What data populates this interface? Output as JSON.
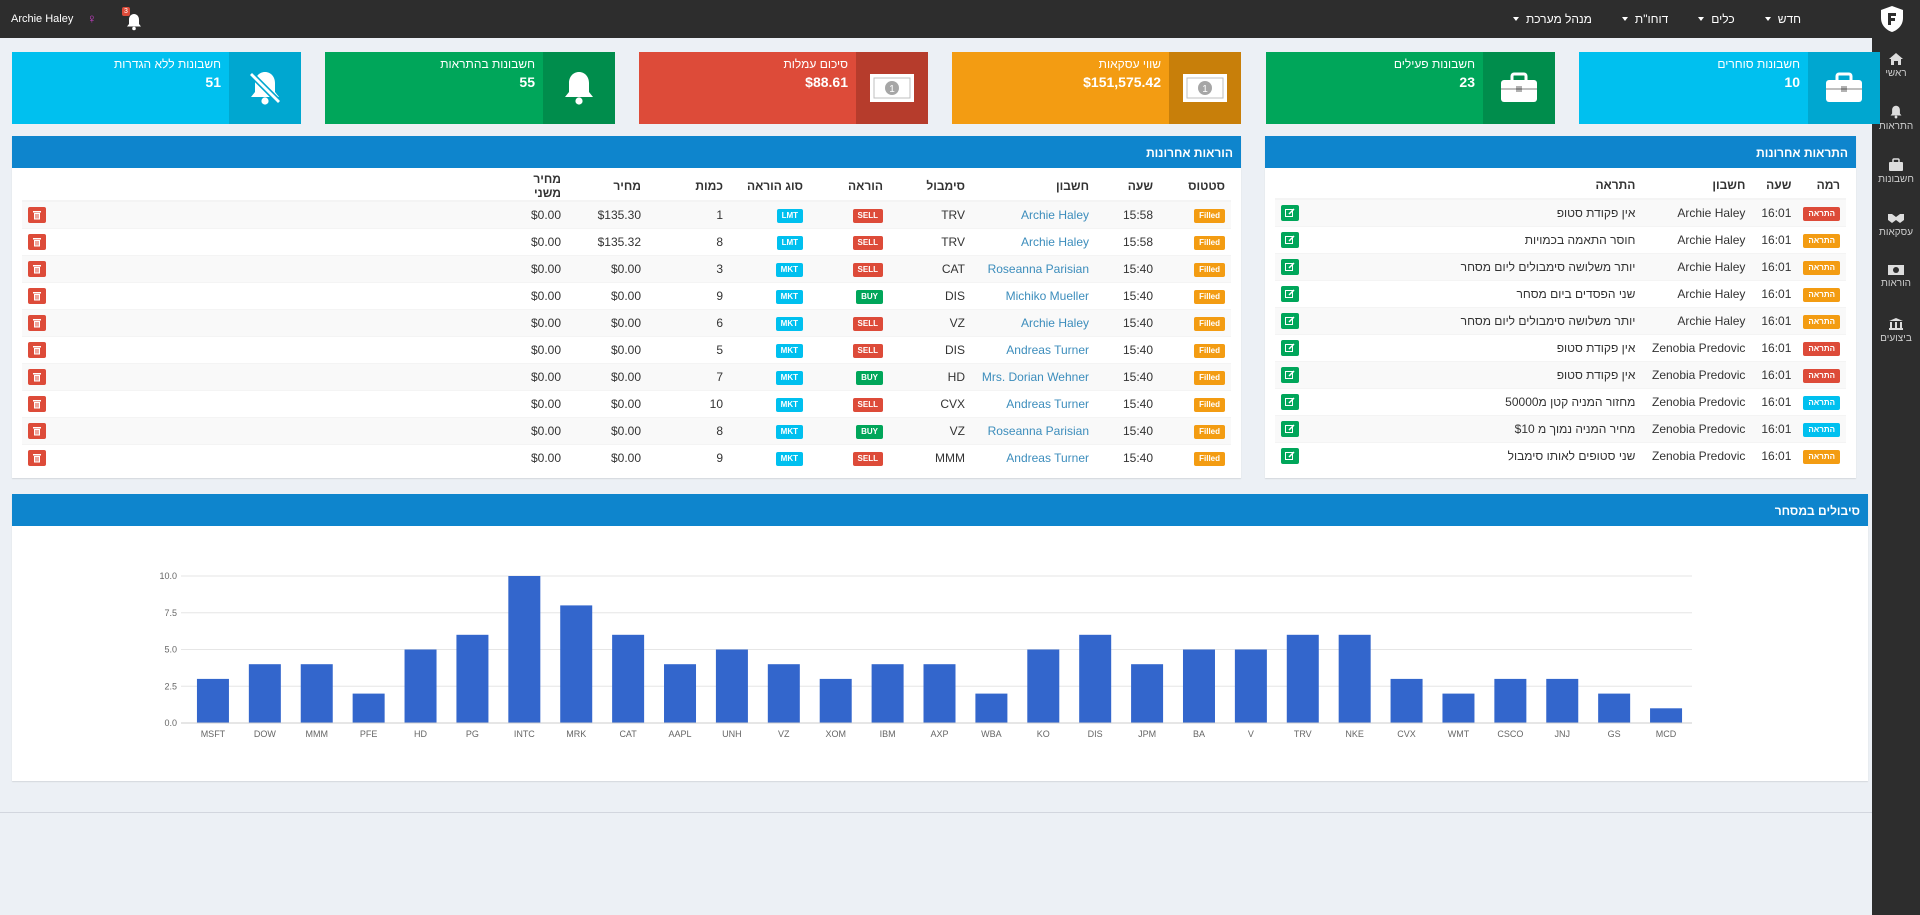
{
  "topbar": {
    "user_name": "Archie Haley",
    "gender_symbol": "♀",
    "notifications_count": "3",
    "nav": [
      {
        "label": "חדש"
      },
      {
        "label": "כלים"
      },
      {
        "label": "דוחו\"ת"
      },
      {
        "label": "מנהל מערכת"
      }
    ]
  },
  "sidebar": {
    "items": [
      {
        "label": "ראשי",
        "icon": "home-icon"
      },
      {
        "label": "התראות",
        "icon": "bell-icon"
      },
      {
        "label": "חשבונות",
        "icon": "briefcase-icon"
      },
      {
        "label": "עסקאות",
        "icon": "handshake-icon"
      },
      {
        "label": "הוראות",
        "icon": "money-icon"
      },
      {
        "label": "ביצועים",
        "icon": "bank-icon"
      }
    ]
  },
  "info_boxes": [
    {
      "title": "חשבונות סוחרים",
      "value": "10",
      "color": "#00c0ef",
      "icon_bg": "#00a7d0",
      "icon": "briefcase-icon"
    },
    {
      "title": "חשבונות פעילים",
      "value": "23",
      "color": "#00a65a",
      "icon_bg": "#008d4c",
      "icon": "briefcase-icon"
    },
    {
      "title": "שווי עסקאות",
      "value": "$151,575.42",
      "color": "#f39c12",
      "icon_bg": "#c87f0a",
      "icon": "money-icon"
    },
    {
      "title": "סיכום עמלות",
      "value": "$88.61",
      "color": "#dd4b39",
      "icon_bg": "#b63c2c",
      "icon": "money-icon"
    },
    {
      "title": "חשבונות בהתראות",
      "value": "55",
      "color": "#00a65a",
      "icon_bg": "#008d4c",
      "icon": "bell-icon"
    },
    {
      "title": "חשבונות ללא הגדרות",
      "value": "51",
      "color": "#00c0ef",
      "icon_bg": "#00a7d0",
      "icon": "bell-slash-icon"
    }
  ],
  "alerts_panel": {
    "title": "התראות אחרונות",
    "headers": [
      "רמה",
      "שעה",
      "חשבון",
      "התראה"
    ],
    "rows": [
      {
        "level": "התראה",
        "level_color": "red",
        "time": "16:01",
        "account": "Archie Haley",
        "alert": "אין פקודת סטופ"
      },
      {
        "level": "התראה",
        "level_color": "orange",
        "time": "16:01",
        "account": "Archie Haley",
        "alert": "חוסר התאמה בכמויות"
      },
      {
        "level": "התראה",
        "level_color": "orange",
        "time": "16:01",
        "account": "Archie Haley",
        "alert": "יותר משלושה סימבולים ליום מסחר"
      },
      {
        "level": "התראה",
        "level_color": "orange",
        "time": "16:01",
        "account": "Archie Haley",
        "alert": "שני הפסדים ביום מסחר"
      },
      {
        "level": "התראה",
        "level_color": "orange",
        "time": "16:01",
        "account": "Archie Haley",
        "alert": "יותר משלושה סימבולים ליום מסחר"
      },
      {
        "level": "התראה",
        "level_color": "red",
        "time": "16:01",
        "account": "Zenobia Predovic",
        "alert": "אין פקודת סטופ"
      },
      {
        "level": "התראה",
        "level_color": "red",
        "time": "16:01",
        "account": "Zenobia Predovic",
        "alert": "אין פקודת סטופ"
      },
      {
        "level": "התראה",
        "level_color": "cyan",
        "time": "16:01",
        "account": "Zenobia Predovic",
        "alert": "מחזור המניה קטן מ50000"
      },
      {
        "level": "התראה",
        "level_color": "cyan",
        "time": "16:01",
        "account": "Zenobia Predovic",
        "alert": "מחיר המניה נמוך מ $10"
      },
      {
        "level": "התראה",
        "level_color": "orange",
        "time": "16:01",
        "account": "Zenobia Predovic",
        "alert": "שני סטופים לאותו סימבול"
      }
    ]
  },
  "orders_panel": {
    "title": "הוראות אחרונות",
    "headers": [
      "סטטוס",
      "שעה",
      "חשבון",
      "סימבול",
      "הוראה",
      "סוג הוראה",
      "כמות",
      "מחיר",
      "מחיר משני"
    ],
    "rows": [
      {
        "status": "Filled",
        "time": "15:58",
        "account": "Archie Haley",
        "symbol": "TRV",
        "side": "SELL",
        "type": "LMT",
        "qty": "1",
        "price": "$135.30",
        "price2": "$0.00"
      },
      {
        "status": "Filled",
        "time": "15:58",
        "account": "Archie Haley",
        "symbol": "TRV",
        "side": "SELL",
        "type": "LMT",
        "qty": "8",
        "price": "$135.32",
        "price2": "$0.00"
      },
      {
        "status": "Filled",
        "time": "15:40",
        "account": "Roseanna Parisian",
        "symbol": "CAT",
        "side": "SELL",
        "type": "MKT",
        "qty": "3",
        "price": "$0.00",
        "price2": "$0.00"
      },
      {
        "status": "Filled",
        "time": "15:40",
        "account": "Michiko Mueller",
        "symbol": "DIS",
        "side": "BUY",
        "type": "MKT",
        "qty": "9",
        "price": "$0.00",
        "price2": "$0.00"
      },
      {
        "status": "Filled",
        "time": "15:40",
        "account": "Archie Haley",
        "symbol": "VZ",
        "side": "SELL",
        "type": "MKT",
        "qty": "6",
        "price": "$0.00",
        "price2": "$0.00"
      },
      {
        "status": "Filled",
        "time": "15:40",
        "account": "Andreas Turner",
        "symbol": "DIS",
        "side": "SELL",
        "type": "MKT",
        "qty": "5",
        "price": "$0.00",
        "price2": "$0.00"
      },
      {
        "status": "Filled",
        "time": "15:40",
        "account": "Mrs. Dorian Wehner",
        "symbol": "HD",
        "side": "BUY",
        "type": "MKT",
        "qty": "7",
        "price": "$0.00",
        "price2": "$0.00"
      },
      {
        "status": "Filled",
        "time": "15:40",
        "account": "Andreas Turner",
        "symbol": "CVX",
        "side": "SELL",
        "type": "MKT",
        "qty": "10",
        "price": "$0.00",
        "price2": "$0.00"
      },
      {
        "status": "Filled",
        "time": "15:40",
        "account": "Roseanna Parisian",
        "symbol": "VZ",
        "side": "BUY",
        "type": "MKT",
        "qty": "8",
        "price": "$0.00",
        "price2": "$0.00"
      },
      {
        "status": "Filled",
        "time": "15:40",
        "account": "Andreas Turner",
        "symbol": "MMM",
        "side": "SELL",
        "type": "MKT",
        "qty": "9",
        "price": "$0.00",
        "price2": "$0.00"
      }
    ]
  },
  "chart_panel": {
    "title": "סיבולים במסחר"
  },
  "chart_data": {
    "type": "bar",
    "categories": [
      "MSFT",
      "DOW",
      "MMM",
      "PFE",
      "HD",
      "PG",
      "INTC",
      "MRK",
      "CAT",
      "AAPL",
      "UNH",
      "VZ",
      "XOM",
      "IBM",
      "AXP",
      "WBA",
      "KO",
      "DIS",
      "JPM",
      "BA",
      "V",
      "TRV",
      "NKE",
      "CVX",
      "WMT",
      "CSCO",
      "JNJ",
      "GS",
      "MCD"
    ],
    "values": [
      3,
      4,
      4,
      2,
      5,
      6,
      10,
      8,
      6,
      4,
      5,
      4,
      3,
      4,
      4,
      2,
      5,
      6,
      4,
      5,
      5,
      6,
      6,
      3,
      2,
      3,
      3,
      2,
      1
    ],
    "yticks": [
      "0.0",
      "2.5",
      "5.0",
      "7.5",
      "10.0"
    ],
    "ylim": [
      0,
      10
    ],
    "bar_color": "#3366cc",
    "grid": true
  }
}
